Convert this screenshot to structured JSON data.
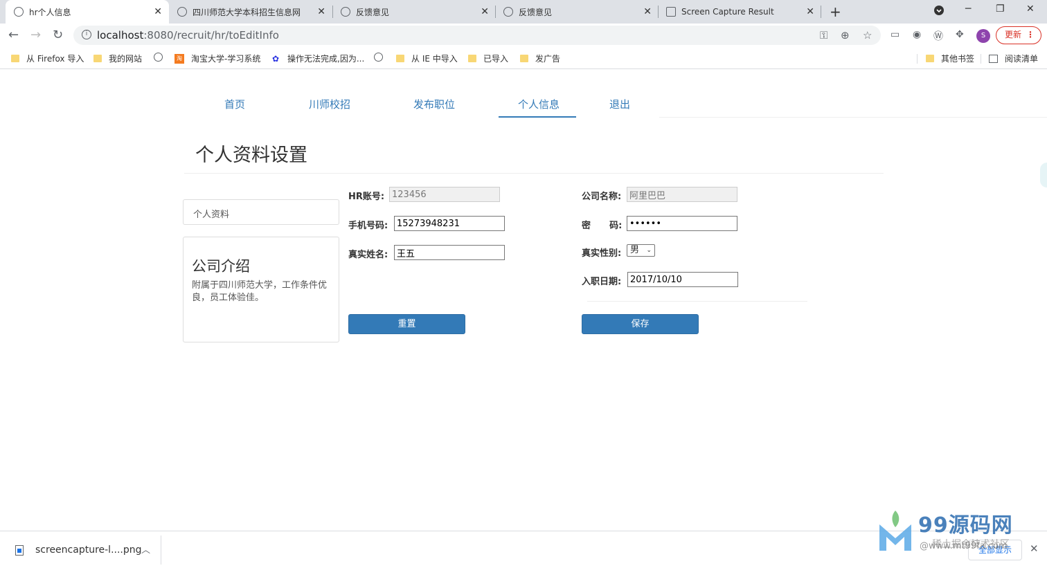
{
  "browser": {
    "tabs": [
      {
        "title": "hr个人信息",
        "active": true
      },
      {
        "title": "四川师范大学本科招生信息网",
        "active": false
      },
      {
        "title": "反馈意见",
        "active": false
      },
      {
        "title": "反馈意见",
        "active": false
      },
      {
        "title": "Screen Capture Result",
        "active": false
      }
    ],
    "url_host": "localhost",
    "url_rest": ":8080/recruit/hr/toEditInfo",
    "avatar_letter": "S",
    "update_label": "更新",
    "bookmarks": [
      {
        "label": "从 Firefox 导入",
        "icon": "folder-icon"
      },
      {
        "label": "我的网站",
        "icon": "folder-icon"
      },
      {
        "label": "",
        "icon": "globe-icon"
      },
      {
        "label": "淘宝大学-学习系统",
        "icon": "taobao-icon"
      },
      {
        "label": "操作无法完成,因为...",
        "icon": "baidu-paw-icon"
      },
      {
        "label": "",
        "icon": "globe-icon"
      },
      {
        "label": "从 IE 中导入",
        "icon": "folder-icon"
      },
      {
        "label": "已导入",
        "icon": "folder-icon"
      },
      {
        "label": "发广告",
        "icon": "folder-icon"
      }
    ],
    "bookmarks_right": [
      {
        "label": "其他书签",
        "icon": "folder-icon"
      },
      {
        "label": "阅读清单",
        "icon": "reading-list-icon"
      }
    ]
  },
  "nav": {
    "items": [
      "首页",
      "川师校招",
      "发布职位",
      "个人信息",
      "退出"
    ],
    "active_index": 3
  },
  "page": {
    "title": "个人资料设置",
    "sidebar_item": "个人资料",
    "intro_title": "公司介绍",
    "intro_text": "附属于四川师范大学，工作条件优良，员工体验佳。"
  },
  "form": {
    "hr_account_label": "HR账号:",
    "hr_account_value": "123456",
    "phone_label": "手机号码:",
    "phone_value": "15273948231",
    "realname_label": "真实姓名:",
    "realname_value": "王五",
    "company_label": "公司名称:",
    "company_value": "阿里巴巴",
    "password_label": "密      码:",
    "password_value": "••••••",
    "gender_label": "真实性别:",
    "gender_value": "男",
    "joindate_label": "入职日期:",
    "joindate_value": "2017/10/10",
    "reset_label": "重置",
    "save_label": "保存"
  },
  "downloads": {
    "file_name": "screencapture-l....png",
    "show_all": "全部显示"
  },
  "watermark": {
    "brand": "99源码网",
    "sub": "稀土掘金技术社区",
    "url": "@www.mt99fa.com"
  },
  "colors": {
    "accent": "#337ab7",
    "update_red": "#d93025"
  }
}
